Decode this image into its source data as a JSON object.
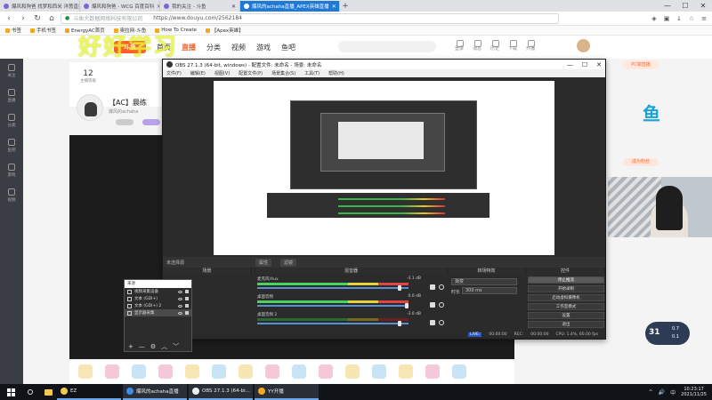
{
  "browser": {
    "tabs": [
      {
        "title": "爆风和狗爸 找梦和西米 洋葱直播"
      },
      {
        "title": "爆风和狗爸 - WCG 百度百科"
      },
      {
        "title": "我的关注 - 斗鱼"
      },
      {
        "title": "爆风的achaha直播_APEX英雄直播",
        "active": true
      }
    ],
    "new_tab": "+",
    "window_controls": [
      "—",
      "☐",
      "✕"
    ],
    "url_prefix": "斗鱼大数据网络科技有限公司",
    "url": "https://www.douyu.com/2562184",
    "bookmarks": [
      "书签",
      "手机书签",
      "EnergyAC首页",
      "奥拉网-斗鱼",
      "How To Create",
      "【Apex英雄】"
    ]
  },
  "douyu": {
    "overlay_text": "好好学习",
    "logo": "斗鱼",
    "nav": [
      {
        "label": "首页"
      },
      {
        "label": "直播",
        "active": true
      },
      {
        "label": "分类"
      },
      {
        "label": "视频"
      },
      {
        "label": "游戏"
      },
      {
        "label": "鱼吧"
      }
    ],
    "top_icons": [
      "登录",
      "消息",
      "历史",
      "下载",
      "开播"
    ],
    "rail": [
      "关注",
      "直播",
      "分类",
      "鱼吧",
      "游戏",
      "视频"
    ],
    "anchor": {
      "stat_value": "12",
      "stat_label": "主播等级",
      "name": "【AC】晨练",
      "sub": "爆风的achaha"
    },
    "pc_badge": "PC端直播",
    "fan_badge": "鱼",
    "fan_btn": "成为粉丝",
    "ticker": {
      "num": "31",
      "up": "0.7",
      "down": "0.1"
    }
  },
  "obs": {
    "title": "OBS 27.1.3 (64-bit, windows) - 配置文件: 未命名 - 场景: 未命名",
    "window_controls": [
      "—",
      "☐",
      "✕"
    ],
    "menu": [
      "文件(F)",
      "编辑(E)",
      "视图(V)",
      "配置文件(P)",
      "场景集合(S)",
      "工具(T)",
      "帮助(H)"
    ],
    "bar": {
      "scene": "未选择源",
      "props": [
        "属性",
        "滤镜"
      ]
    },
    "headers": [
      "场景",
      "来源",
      "混音器",
      "转场特效",
      "控件"
    ],
    "mixer": [
      {
        "label": "麦克风/Aux",
        "db": "-3.1 dB",
        "lit": true
      },
      {
        "label": "桌面音频",
        "db": "0.0 dB",
        "lit": true
      },
      {
        "label": "桌面音频 2",
        "db": "-3.0 dB",
        "lit": false
      }
    ],
    "transition": {
      "select": "渐变",
      "duration_label": "时长",
      "duration": "300 ms"
    },
    "controls": [
      "停止推流",
      "开始录制",
      "启动虚拟摄像机",
      "工作室模式",
      "设置",
      "退出"
    ],
    "status": {
      "live": "LIVE:",
      "live_time": "00:00:00",
      "rec": "REC:",
      "rec_time": "00:00:00",
      "cpu": "CPU: 1.4%, 60.00 fps"
    },
    "dock": {
      "title": "来源",
      "sources": [
        {
          "label": "视频采集设备"
        },
        {
          "label": "文本 (GDI+)"
        },
        {
          "label": "文本 (GDI+) 2"
        },
        {
          "label": "显示器采集",
          "selected": true
        }
      ],
      "tools": [
        "+",
        "—",
        "⚙",
        "︿",
        "﹀"
      ]
    }
  },
  "taskbar": {
    "apps": [
      {
        "label": "EZ",
        "color": "#f2c94c"
      },
      {
        "label": "爆风的achaha直播",
        "color": "#3b8fe8"
      },
      {
        "label": "OBS 27.1.3 (64-bi...",
        "color": "#eeeeee"
      },
      {
        "label": "YY开播",
        "color": "#f5a623"
      }
    ],
    "tray": [
      "^",
      "🔊",
      "中"
    ],
    "time": "10:23:17",
    "date": "2021/11/25"
  }
}
